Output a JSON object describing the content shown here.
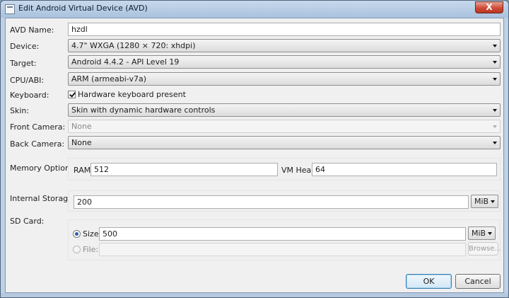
{
  "window": {
    "title": "Edit Android Virtual Device (AVD)",
    "close_label": "X"
  },
  "fields": {
    "avd_name": {
      "label": "AVD Name:",
      "value": "hzdl"
    },
    "device": {
      "label": "Device:",
      "value": "4.7\" WXGA (1280 × 720: xhdpi)"
    },
    "target": {
      "label": "Target:",
      "value": "Android 4.4.2 - API Level 19"
    },
    "cpu_abi": {
      "label": "CPU/ABI:",
      "value": "ARM (armeabi-v7a)"
    },
    "keyboard": {
      "label": "Keyboard:",
      "checkbox_label": "Hardware keyboard present",
      "checked": true
    },
    "skin": {
      "label": "Skin:",
      "value": "Skin with dynamic hardware controls"
    },
    "front_camera": {
      "label": "Front Camera:",
      "value": "None"
    },
    "back_camera": {
      "label": "Back Camera:",
      "value": "None"
    },
    "memory": {
      "label": "Memory Options:",
      "ram_label": "RAM:",
      "ram_value": "512",
      "vm_heap_label": "VM Heap:",
      "vm_heap_value": "64"
    },
    "internal_storage": {
      "label": "Internal Storage:",
      "value": "200",
      "unit": "MiB"
    },
    "sd_card": {
      "label": "SD Card:",
      "size_label": "Size:",
      "size_value": "500",
      "size_unit": "MiB",
      "file_label": "File:",
      "file_value": "",
      "browse_label": "Browse..."
    }
  },
  "buttons": {
    "ok": "OK",
    "cancel": "Cancel"
  }
}
